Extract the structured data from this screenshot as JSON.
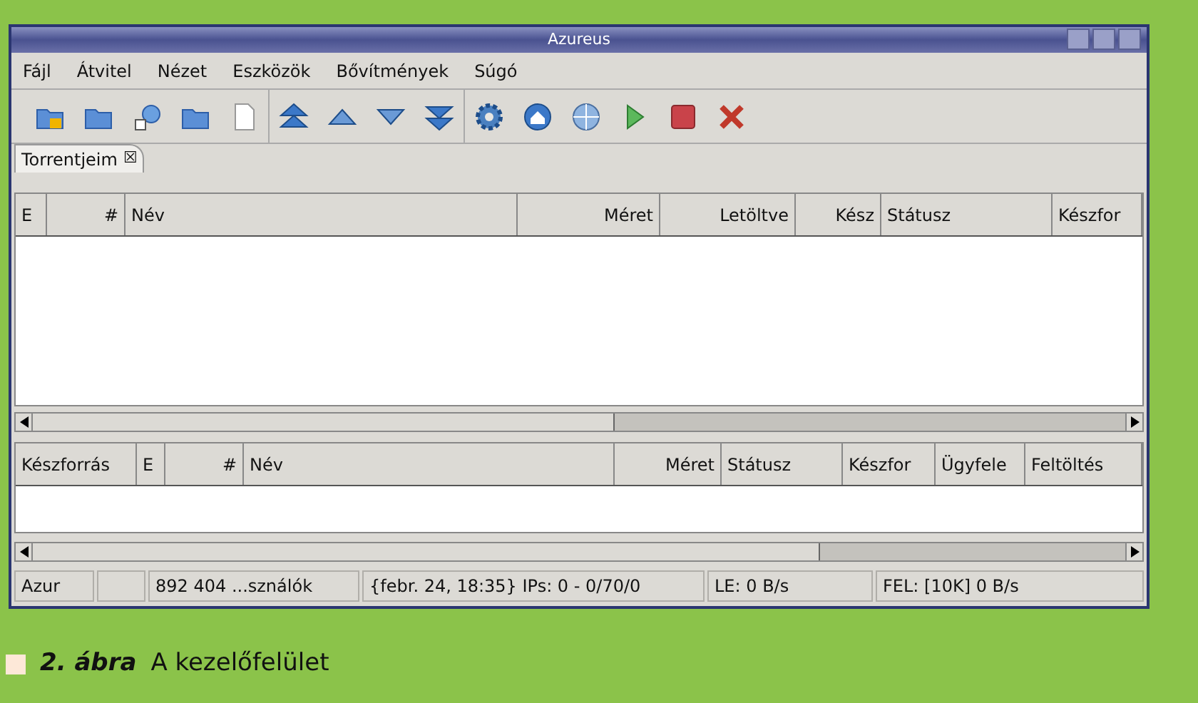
{
  "window": {
    "title": "Azureus"
  },
  "menu": [
    "Fájl",
    "Átvitel",
    "Nézet",
    "Eszközök",
    "Bővítmények",
    "Súgó"
  ],
  "tabs": [
    {
      "label": "Torrentjeim",
      "close": "☒",
      "selected": true
    }
  ],
  "torrents_table": {
    "columns": [
      {
        "label": "E",
        "kind": "text"
      },
      {
        "label": "#",
        "kind": "number"
      },
      {
        "label": "Név",
        "kind": "text"
      },
      {
        "label": "Méret",
        "kind": "number"
      },
      {
        "label": "Letöltve",
        "kind": "number"
      },
      {
        "label": "Kész",
        "kind": "number"
      },
      {
        "label": "Státusz",
        "kind": "text"
      },
      {
        "label": "Készfor",
        "kind": "text"
      }
    ]
  },
  "seeds_table": {
    "columns": [
      {
        "label": "Készforrás",
        "kind": "text"
      },
      {
        "label": "E",
        "kind": "text"
      },
      {
        "label": "#",
        "kind": "number"
      },
      {
        "label": "Név",
        "kind": "text"
      },
      {
        "label": "Méret",
        "kind": "number"
      },
      {
        "label": "Státusz",
        "kind": "text"
      },
      {
        "label": "Készfor",
        "kind": "text"
      },
      {
        "label": "Ügyfele",
        "kind": "text"
      },
      {
        "label": "Feltöltés",
        "kind": "text"
      }
    ]
  },
  "status_bar": [
    "Azur",
    "892 404 ...sználók",
    "{febr. 24, 18:35} IPs: 0 - 0/70/0",
    "LE: 0 B/s",
    "FEL: [10K] 0 B/s"
  ],
  "caption": {
    "number": "2. ábra",
    "text": "A kezelőfelület"
  }
}
